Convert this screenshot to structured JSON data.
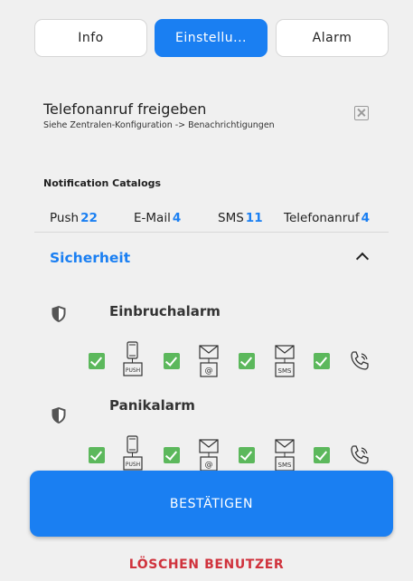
{
  "tabs": [
    {
      "label": "Info",
      "active": false
    },
    {
      "label": "Einstellu...",
      "active": true
    },
    {
      "label": "Alarm",
      "active": false
    }
  ],
  "phone_call": {
    "title": "Telefonanruf freigeben",
    "subtitle": "Siehe Zentralen-Konfiguration -> Benachrichtigungen"
  },
  "catalogs": {
    "title": "Notification Catalogs",
    "items": [
      {
        "label": "Push",
        "count": "22"
      },
      {
        "label": "E-Mail",
        "count": "4"
      },
      {
        "label": "SMS",
        "count": "11"
      },
      {
        "label": "Telefonanruf",
        "count": "4"
      }
    ]
  },
  "section": {
    "title": "Sicherheit",
    "expanded": true
  },
  "alarms": [
    {
      "name": "Einbruchalarm",
      "push": true,
      "email": true,
      "sms": true,
      "phone": true
    },
    {
      "name": "Panikalarm",
      "push": true,
      "email": true,
      "sms": true,
      "phone": true
    }
  ],
  "icon_labels": {
    "push": "PUSH",
    "email": "@",
    "sms": "SMS"
  },
  "buttons": {
    "confirm": "BESTÄTIGEN",
    "delete": "LÖSCHEN BENUTZER"
  },
  "colors": {
    "accent": "#1a7ff2",
    "check": "#5cb85c",
    "danger": "#d0323c",
    "background": "#f0f0f0"
  }
}
